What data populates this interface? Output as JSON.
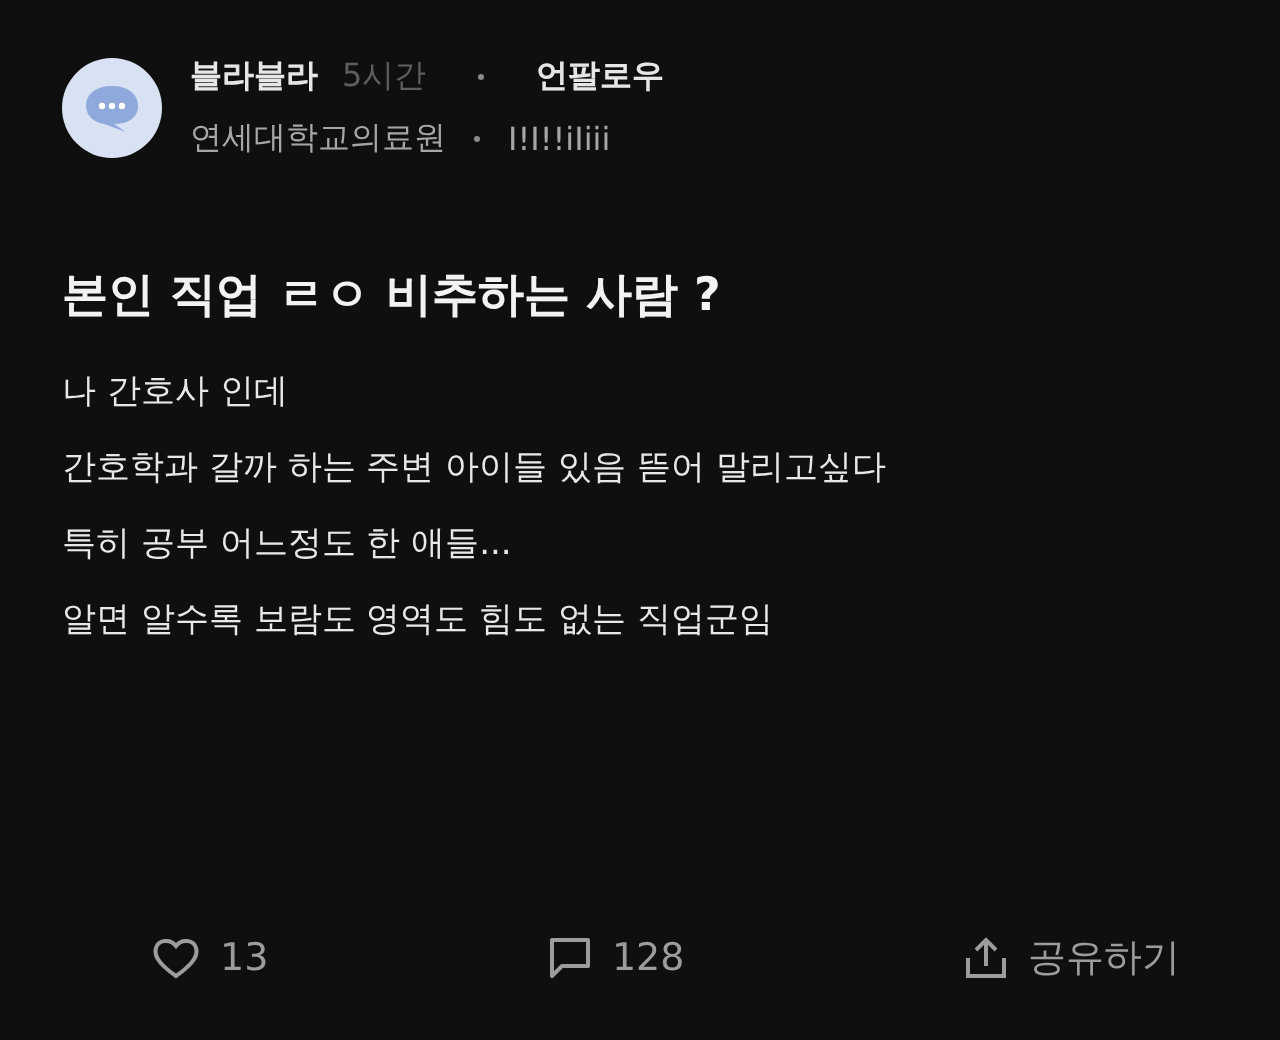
{
  "author": {
    "name": "블라블라",
    "time": "5시간",
    "follow": "언팔로우",
    "company": "연세대학교의료원",
    "nickname": "I!I!!iIiii"
  },
  "post": {
    "title": "본인 직업 ㄹㅇ 비추하는 사람 ?",
    "lines": [
      "나 간호사 인데",
      "간호학과 갈까 하는 주변 아이들 있음 뜯어 말리고싶다",
      "특히 공부 어느정도 한 애들...",
      "알면 알수록 보람도 영역도 힘도 없는 직업군임"
    ]
  },
  "actions": [
    {
      "kind": "like",
      "label": "13"
    },
    {
      "kind": "comment",
      "label": "128"
    },
    {
      "kind": "share",
      "label": "공유하기"
    }
  ]
}
